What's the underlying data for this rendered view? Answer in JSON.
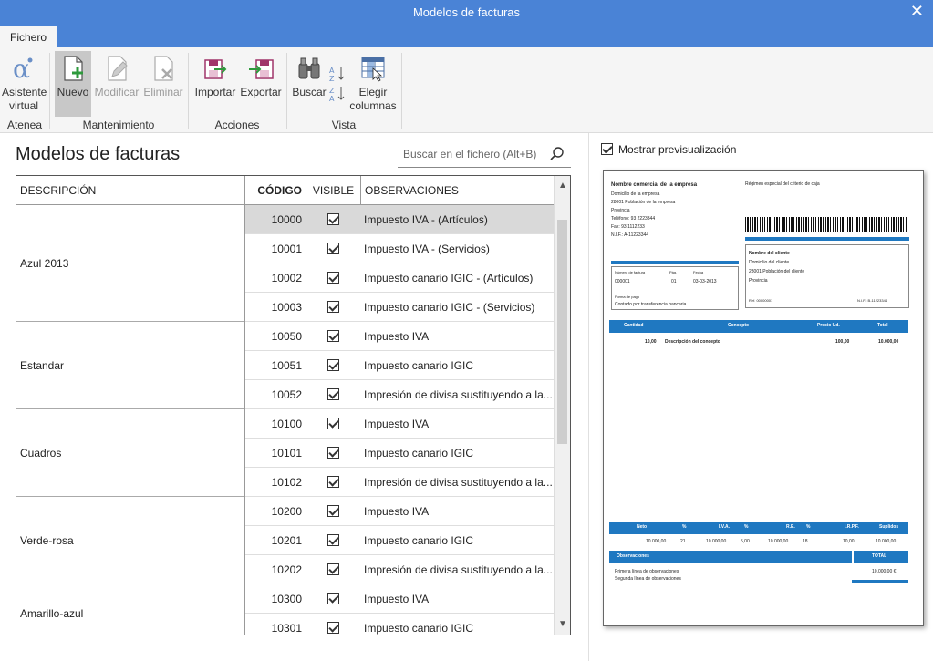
{
  "window": {
    "title": "Modelos de facturas",
    "close_label": "✕"
  },
  "menu": {
    "tab": "Fichero"
  },
  "ribbon": {
    "buttons": {
      "asistente": "Asistente virtual",
      "nuevo": "Nuevo",
      "modificar": "Modificar",
      "eliminar": "Eliminar",
      "importar": "Importar",
      "exportar": "Exportar",
      "buscar": "Buscar",
      "elegir": "Elegir columnas"
    },
    "groups": {
      "atenea": "Atenea",
      "mantenimiento": "Mantenimiento",
      "acciones": "Acciones",
      "vista": "Vista"
    }
  },
  "main": {
    "title": "Modelos de facturas",
    "search_placeholder": "Buscar en el fichero (Alt+B)"
  },
  "table": {
    "headers": {
      "descripcion": "DESCRIPCIÓN",
      "codigo": "CÓDIGO",
      "visible": "VISIBLE",
      "observaciones": "OBSERVACIONES"
    },
    "groups": [
      {
        "descripcion": "Azul 2013",
        "rows": [
          {
            "codigo": "10000",
            "visible": true,
            "obs": "Impuesto IVA - (Artículos)",
            "selected": true
          },
          {
            "codigo": "10001",
            "visible": true,
            "obs": "Impuesto IVA - (Servicios)"
          },
          {
            "codigo": "10002",
            "visible": true,
            "obs": "Impuesto canario IGIC - (Artículos)"
          },
          {
            "codigo": "10003",
            "visible": true,
            "obs": "Impuesto canario IGIC - (Servicios)"
          }
        ]
      },
      {
        "descripcion": "Estandar",
        "rows": [
          {
            "codigo": "10050",
            "visible": true,
            "obs": "Impuesto IVA"
          },
          {
            "codigo": "10051",
            "visible": true,
            "obs": "Impuesto canario IGIC"
          },
          {
            "codigo": "10052",
            "visible": true,
            "obs": "Impresión de divisa sustituyendo a la..."
          }
        ]
      },
      {
        "descripcion": "Cuadros",
        "rows": [
          {
            "codigo": "10100",
            "visible": true,
            "obs": "Impuesto IVA"
          },
          {
            "codigo": "10101",
            "visible": true,
            "obs": "Impuesto canario IGIC"
          },
          {
            "codigo": "10102",
            "visible": true,
            "obs": "Impresión de divisa sustituyendo a la..."
          }
        ]
      },
      {
        "descripcion": "Verde-rosa",
        "rows": [
          {
            "codigo": "10200",
            "visible": true,
            "obs": "Impuesto IVA"
          },
          {
            "codigo": "10201",
            "visible": true,
            "obs": "Impuesto canario IGIC"
          },
          {
            "codigo": "10202",
            "visible": true,
            "obs": "Impresión de divisa sustituyendo a la..."
          }
        ]
      },
      {
        "descripcion": "Amarillo-azul",
        "rows": [
          {
            "codigo": "10300",
            "visible": true,
            "obs": "Impuesto IVA"
          },
          {
            "codigo": "10301",
            "visible": true,
            "obs": "Impuesto canario IGIC"
          }
        ]
      }
    ]
  },
  "preview": {
    "checkbox_label": "Mostrar previsualización",
    "checked": true,
    "company_name": "Nombre comercial de la empresa",
    "company_lines": [
      "Domicilio de la empresa",
      "28001   Población de la empresa",
      "Provincia",
      "Teléfono:   93 2223344",
      "Fax:   93 1112233",
      "N.I.F.:   A-11223344"
    ],
    "regime": "Régimen especial del criterio de caja",
    "client_title": "Nombre del cliente",
    "client_lines": [
      "Domicilio del cliente",
      "28001 Población del cliente",
      "Provincia"
    ],
    "client_ref": "Ref.   00000001",
    "client_nif": "N.I.F.:   B-11223344",
    "invoice_labels": [
      "Número de factura",
      "Pág.",
      "Fecha"
    ],
    "invoice_values": [
      "000001",
      "01",
      "03-03-2013"
    ],
    "payment_label": "Forma de pago",
    "payment_value": "Contado por transferencia bancaria",
    "items_headers": [
      "Cantidad",
      "Concepto",
      "Precio Ud.",
      "Total"
    ],
    "item": {
      "cantidad": "10,00",
      "concepto": "Descripción del concepto",
      "precio": "100,00",
      "total": "10.000,00"
    },
    "totals_headers": [
      "Neto",
      "%",
      "I.V.A.",
      "%",
      "R.E.",
      "%",
      "I.R.P.F.",
      "Suplidos"
    ],
    "totals_values": [
      "10.000,00",
      "21",
      "10.000,00",
      "5,00",
      "10.000,00",
      "18",
      "10,00",
      "10.000,00"
    ],
    "observ_label": "Observaciones",
    "total_label": "TOTAL",
    "observ_lines": [
      "Primera línea de observaciones",
      "Segunda línea de observaciones"
    ],
    "total_value": "10.000,00  €"
  },
  "colors": {
    "titlebar": "#4a83d6",
    "preview_blue": "#1f78c1",
    "selected_row": "#d9d9d9"
  }
}
